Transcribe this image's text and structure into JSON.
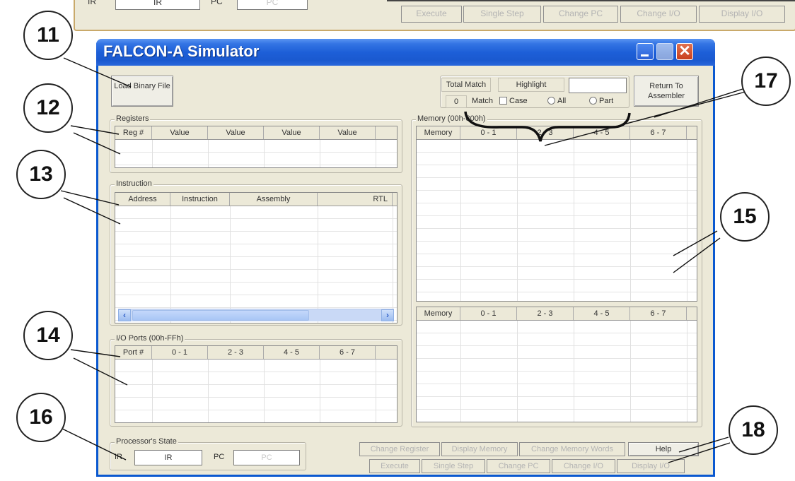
{
  "top_strip": {
    "ir_label": "IR",
    "ir_value": "IR",
    "pc_label": "PC",
    "pc_value": "PC",
    "buttons": [
      "Execute",
      "Single Step",
      "Change PC",
      "Change I/O",
      "Display I/O"
    ]
  },
  "window": {
    "title": "FALCON-A Simulator",
    "close_glyph": "✕"
  },
  "toolbar": {
    "load_button": "Load Binary File",
    "total_match_label": "Total Match",
    "total_match_value": "0",
    "highlight_label": "Highlight",
    "highlight_value": "",
    "match_label": "Match",
    "case_label": "Case",
    "all_label": "All",
    "part_label": "Part",
    "return_button": "Return To Assembler"
  },
  "registers": {
    "title": "Registers",
    "columns": [
      "Reg #",
      "Value",
      "Value",
      "Value",
      "Value"
    ]
  },
  "instruction": {
    "title": "Instruction",
    "columns": [
      "Address",
      "Instruction",
      "Assembly",
      "RTL"
    ]
  },
  "io_ports": {
    "title": "I/O Ports (00h-FFh)",
    "columns": [
      "Port #",
      "0 - 1",
      "2 - 3",
      "4 - 5",
      "6 - 7"
    ]
  },
  "memory": {
    "title": "Memory (00h-800h)",
    "columns": [
      "Memory",
      "0 - 1",
      "2 - 3",
      "4 - 5",
      "6 - 7"
    ]
  },
  "memory2": {
    "columns": [
      "Memory",
      "0 - 1",
      "2 - 3",
      "4 - 5",
      "6 - 7"
    ]
  },
  "processor_state": {
    "title": "Processor's State",
    "ir_label": "IR",
    "ir_value": "IR",
    "pc_label": "PC",
    "pc_value": "PC"
  },
  "bottom_buttons": {
    "row1": [
      "Change Register",
      "Display Memory",
      "Change Memory Words",
      "Help"
    ],
    "row2": [
      "Execute",
      "Single Step",
      "Change PC",
      "Change I/O",
      "Display I/O"
    ]
  },
  "callouts": [
    "11",
    "12",
    "13",
    "14",
    "15",
    "16",
    "17",
    "18"
  ]
}
